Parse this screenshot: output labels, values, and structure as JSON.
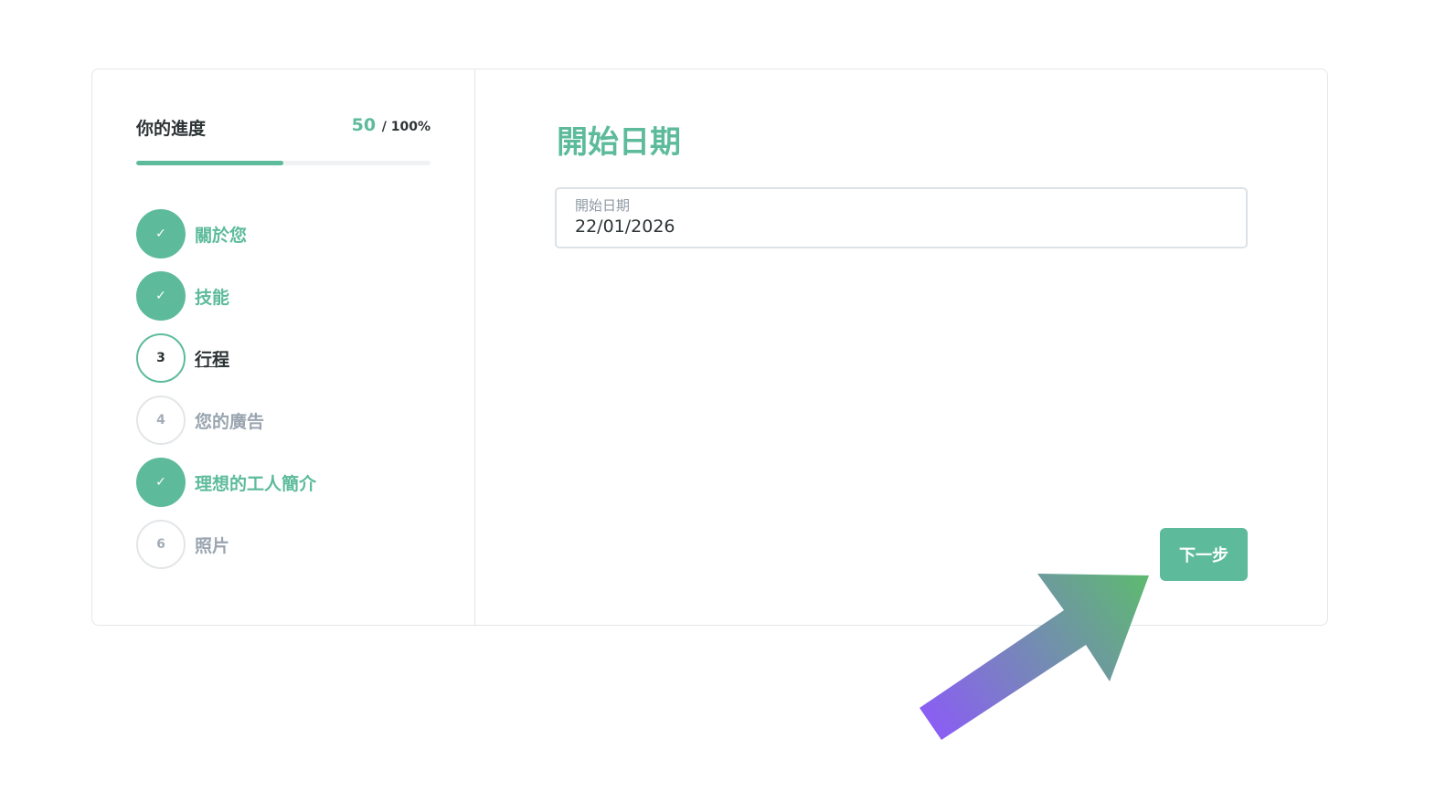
{
  "progress": {
    "title": "你的進度",
    "value": "50",
    "total": "/ 100%",
    "fraction": 0.5
  },
  "steps": [
    {
      "label": "關於您",
      "number": "✓",
      "state": "done",
      "icon": "check-icon"
    },
    {
      "label": "技能",
      "number": "✓",
      "state": "done",
      "icon": "check-icon"
    },
    {
      "label": "行程",
      "number": "3",
      "state": "current"
    },
    {
      "label": "您的廣告",
      "number": "4",
      "state": "todo"
    },
    {
      "label": "理想的工人簡介",
      "number": "✓",
      "state": "done",
      "icon": "check-icon"
    },
    {
      "label": "照片",
      "number": "6",
      "state": "todo"
    }
  ],
  "main": {
    "title": "開始日期",
    "date_label": "開始日期",
    "date_value": "22/01/2026",
    "next_label": "下一步"
  },
  "colors": {
    "accent": "#5dbb9c",
    "arrow_start": "#8b5cf6",
    "arrow_end": "#5dbb6e"
  }
}
